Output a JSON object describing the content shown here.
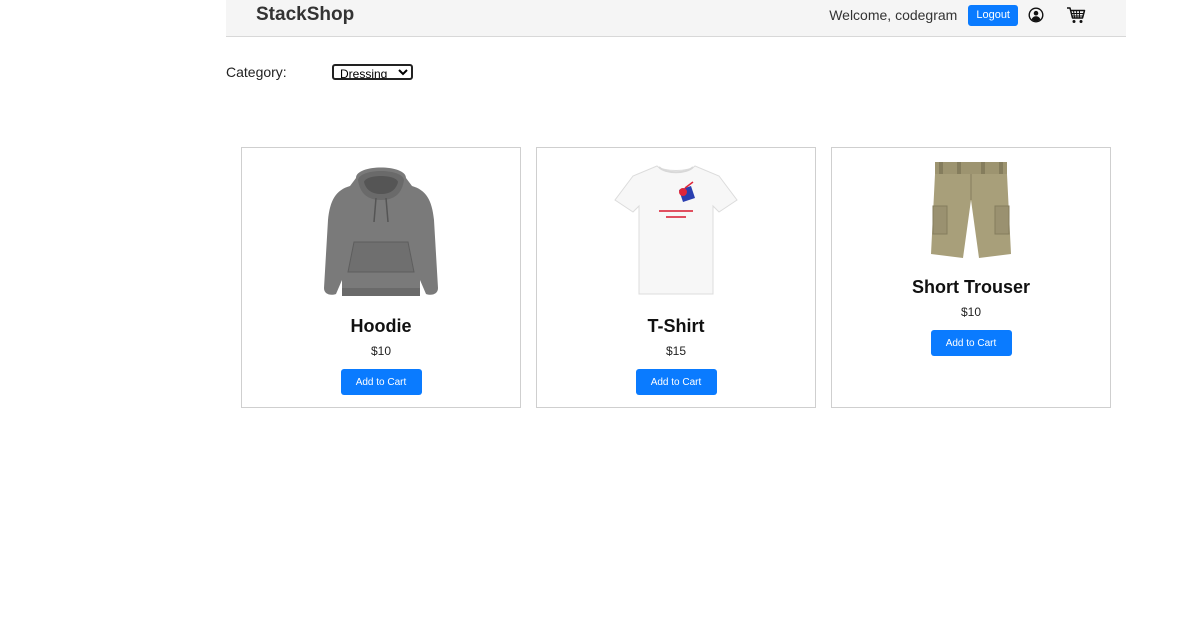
{
  "header": {
    "brand": "StackShop",
    "welcome_text": "Welcome, codegram",
    "logout_label": "Logout",
    "user_icon": "user-circle-icon",
    "cart_icon": "shopping-cart-icon"
  },
  "filter": {
    "label": "Category:",
    "selected": "Dressing"
  },
  "products": [
    {
      "name": "Hoodie",
      "price": "$10",
      "button_label": "Add to Cart",
      "image": "hoodie"
    },
    {
      "name": "T-Shirt",
      "price": "$15",
      "button_label": "Add to Cart",
      "image": "t-shirt"
    },
    {
      "name": "Short Trouser",
      "price": "$10",
      "button_label": "Add to Cart",
      "image": "short-trouser"
    }
  ],
  "colors": {
    "primary": "#0a7bff",
    "navbar_bg": "#f5f5f5",
    "card_border": "#cfcfcf",
    "hoodie": "#7a7a7a",
    "shorts": "#a89f7a"
  }
}
